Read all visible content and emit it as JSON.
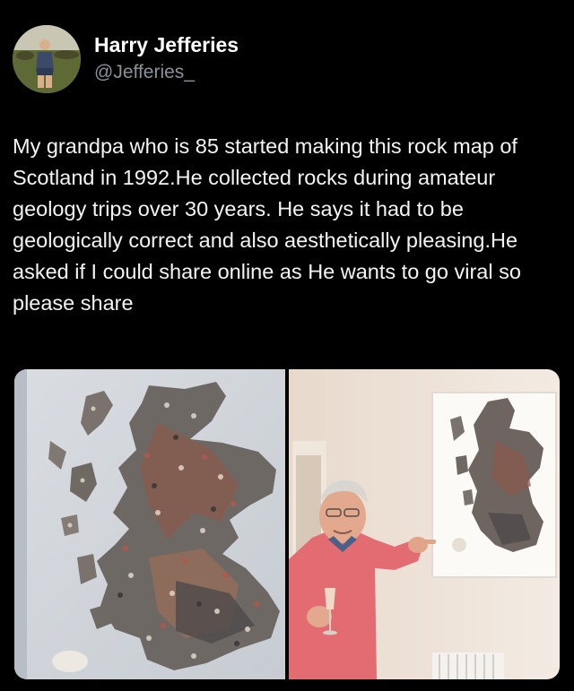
{
  "tweet": {
    "author": {
      "display_name": "Harry Jefferies",
      "handle": "@Jefferies_",
      "avatar_icon": "user-photo-avatar"
    },
    "text": "My grandpa who is 85 started making this rock map of Scotland in 1992.He collected rocks during amateur geology trips over 30 years. He says it had to be geologically correct and also aesthetically pleasing.He asked if I could share online as He wants to go viral so please share",
    "media": [
      {
        "icon": "rock-map-photo"
      },
      {
        "icon": "grandpa-with-map-photo"
      }
    ]
  },
  "colors": {
    "background": "#000000",
    "text": "#f4f4f4",
    "handle": "#8b9198"
  }
}
